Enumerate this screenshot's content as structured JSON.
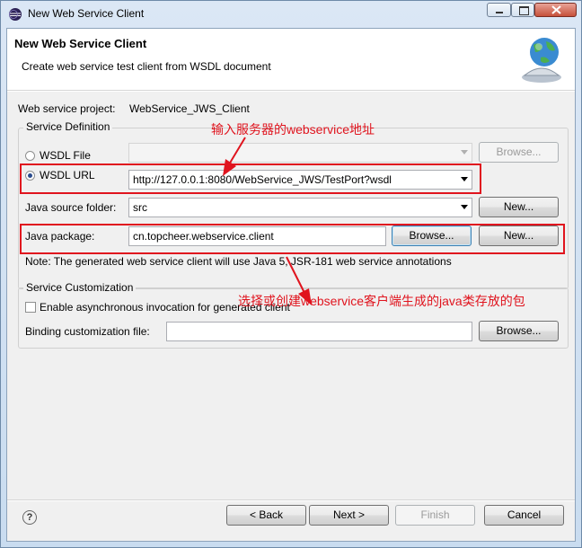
{
  "window": {
    "title": "New Web Service Client"
  },
  "banner": {
    "title": "New Web Service Client",
    "description": "Create web service test client from WSDL document"
  },
  "project": {
    "label": "Web service project:",
    "value": "WebService_JWS_Client"
  },
  "service_definition": {
    "group_label": "Service Definition",
    "wsdl_file": {
      "label": "WSDL File",
      "value": "",
      "browse_label": "Browse..."
    },
    "wsdl_url": {
      "label": "WSDL URL",
      "value": "http://127.0.0.1:8080/WebService_JWS/TestPort?wsdl"
    },
    "source_folder": {
      "label": "Java source folder:",
      "value": "src",
      "new_label": "New..."
    },
    "package": {
      "label": "Java package:",
      "value": "cn.topcheer.webservice.client",
      "browse_label": "Browse...",
      "new_label": "New..."
    },
    "note": "Note: The generated web service client will use Java 5, JSR-181 web service annotations"
  },
  "service_customization": {
    "group_label": "Service Customization",
    "async_label": "Enable asynchronous invocation for generated client",
    "binding_label": "Binding customization file:",
    "binding_value": "",
    "browse_label": "Browse..."
  },
  "buttons": {
    "back": "< Back",
    "next": "Next >",
    "finish": "Finish",
    "cancel": "Cancel"
  },
  "annotations": {
    "url_note": "输入服务器的webservice地址",
    "package_note": "选择或创建webservice客户端生成的java类存放的包"
  },
  "colors": {
    "annotation": "#e0141e"
  }
}
